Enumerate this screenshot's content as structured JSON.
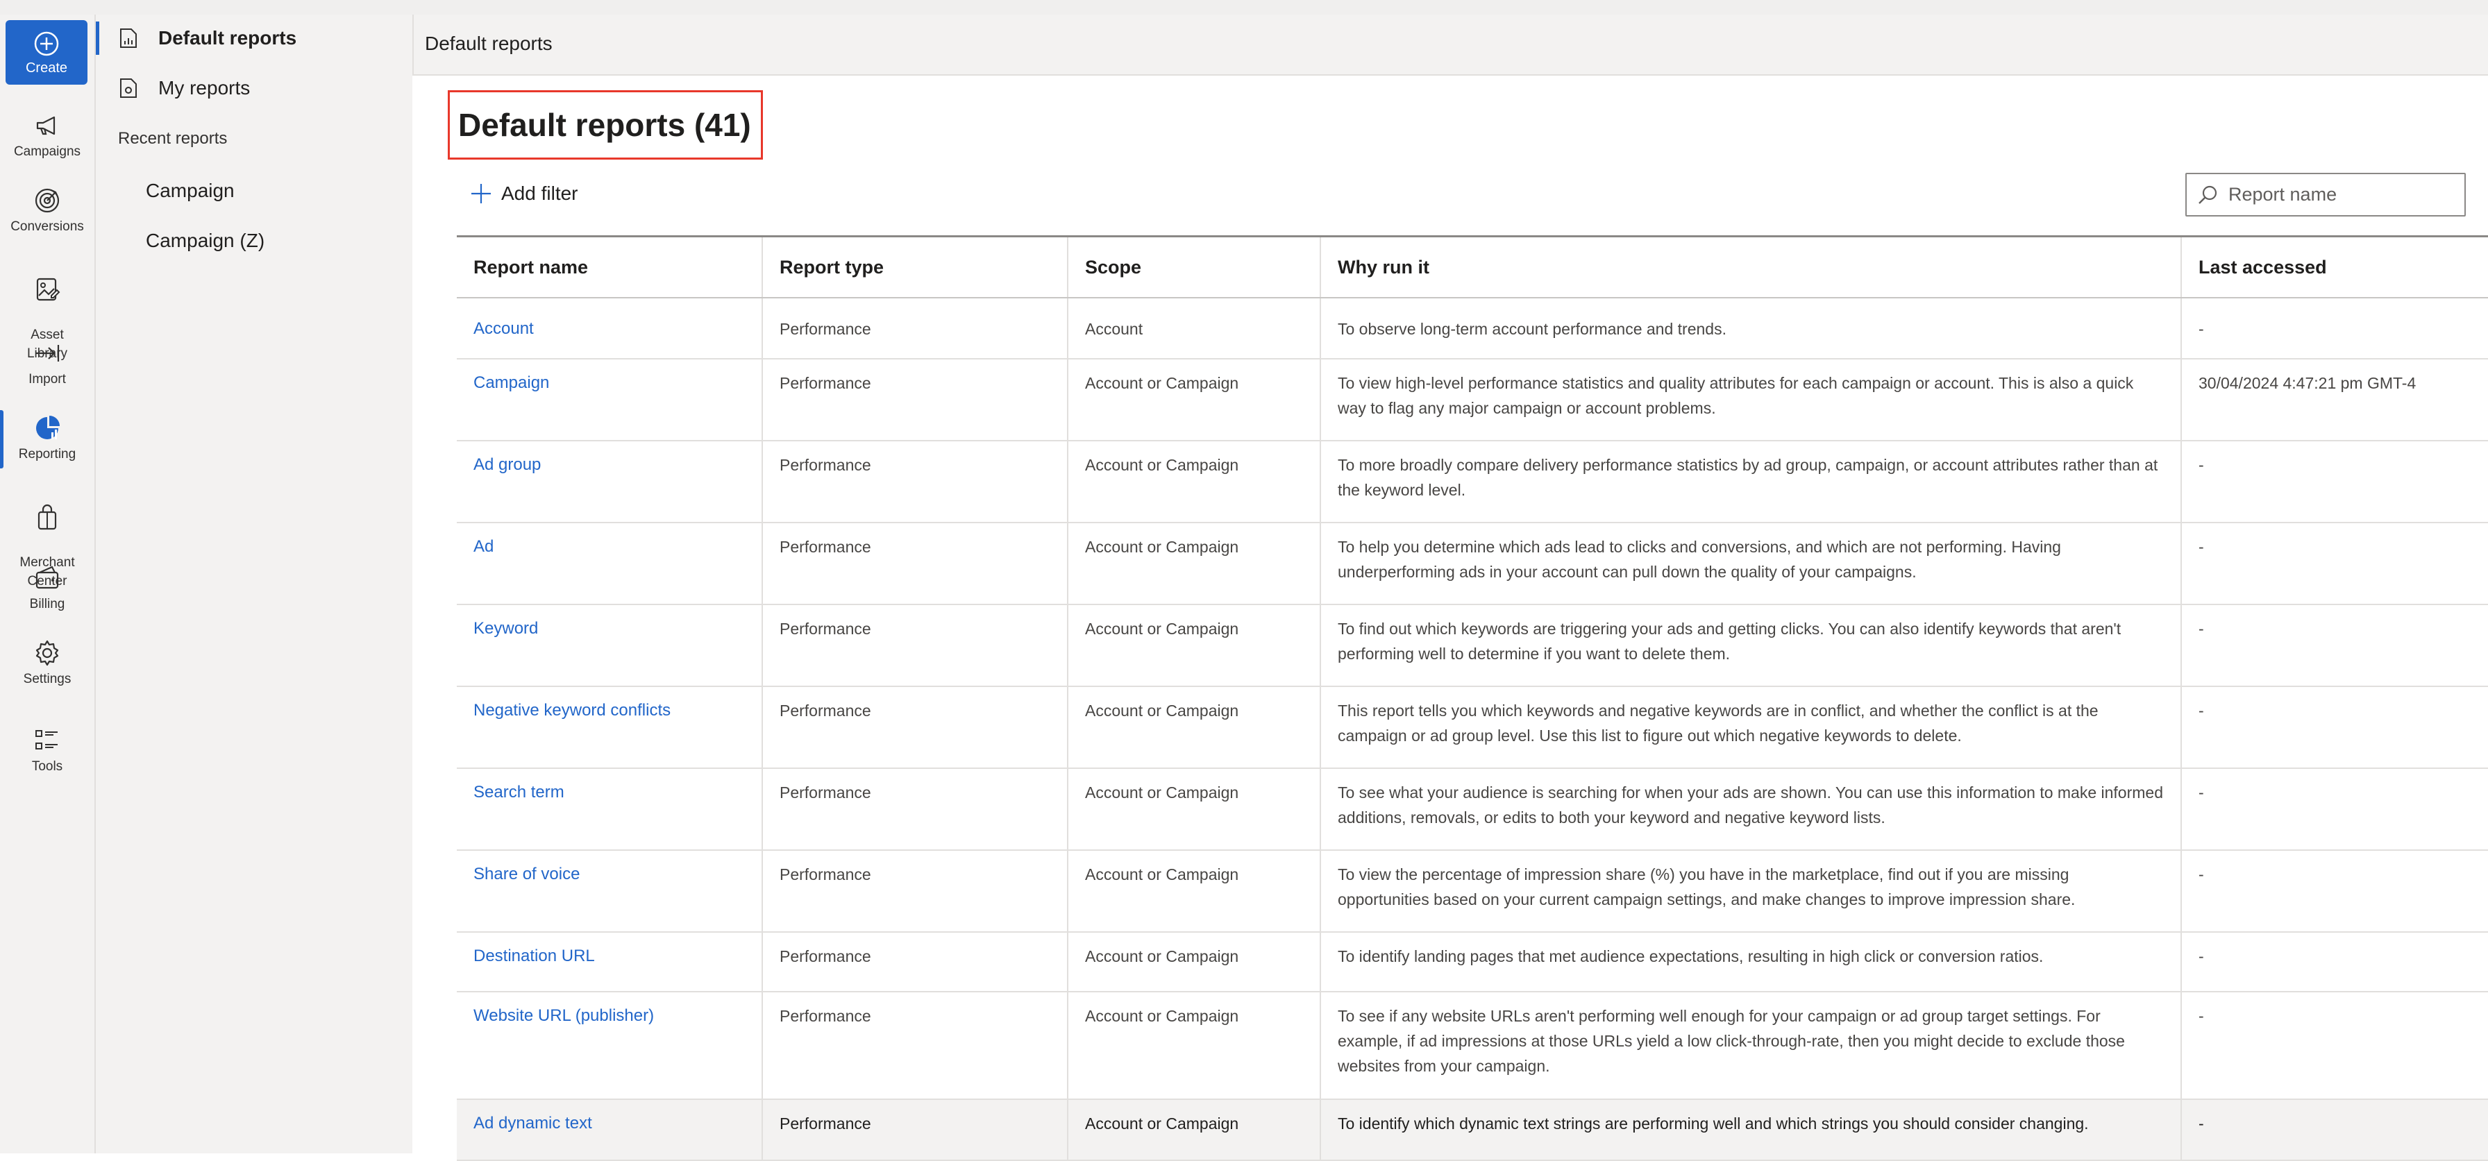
{
  "rail": {
    "create": "Create",
    "items": [
      {
        "label": "Campaigns",
        "icon": "megaphone-icon"
      },
      {
        "label": "Conversions",
        "icon": "target-icon"
      },
      {
        "label": "Asset\nLibrary",
        "icon": "asset-library-icon"
      },
      {
        "label": "Import",
        "icon": "import-icon"
      },
      {
        "label": "Reporting",
        "icon": "pie-chart-icon"
      },
      {
        "label": "Merchant\nCenter",
        "icon": "shopping-bag-icon"
      },
      {
        "label": "Billing",
        "icon": "wallet-icon"
      },
      {
        "label": "Settings",
        "icon": "gear-icon"
      },
      {
        "label": "Tools",
        "icon": "list-icon"
      }
    ]
  },
  "subnav": {
    "default_reports": "Default reports",
    "my_reports": "My reports",
    "recent_heading": "Recent reports",
    "recent": [
      "Campaign",
      "Campaign (Z)"
    ]
  },
  "header": {
    "breadcrumb": "Default reports"
  },
  "main": {
    "title": "Default reports (41)",
    "add_filter": "Add filter",
    "search_placeholder": "Report name"
  },
  "table": {
    "columns": [
      "Report name",
      "Report type",
      "Scope",
      "Why run it",
      "Last accessed"
    ],
    "rows": [
      {
        "name": "Account",
        "type": "Performance",
        "scope": "Account",
        "why": "To observe long-term account performance and trends.",
        "last": "-"
      },
      {
        "name": "Campaign",
        "type": "Performance",
        "scope": "Account or Campaign",
        "why": "To view high-level performance statistics and quality attributes for each campaign or account. This is also a quick way to flag any major campaign or account problems.",
        "last": "30/04/2024 4:47:21 pm GMT-4"
      },
      {
        "name": "Ad group",
        "type": "Performance",
        "scope": "Account or Campaign",
        "why": "To more broadly compare delivery performance statistics by ad group, campaign, or account attributes rather than at the keyword level.",
        "last": "-"
      },
      {
        "name": "Ad",
        "type": "Performance",
        "scope": "Account or Campaign",
        "why": "To help you determine which ads lead to clicks and conversions, and which are not performing. Having underperforming ads in your account can pull down the quality of your campaigns.",
        "last": "-"
      },
      {
        "name": "Keyword",
        "type": "Performance",
        "scope": "Account or Campaign",
        "why": "To find out which keywords are triggering your ads and getting clicks. You can also identify keywords that aren't performing well to determine if you want to delete them.",
        "last": "-"
      },
      {
        "name": "Negative keyword conflicts",
        "type": "Performance",
        "scope": "Account or Campaign",
        "why": "This report tells you which keywords and negative keywords are in conflict, and whether the conflict is at the campaign or ad group level. Use this list to figure out which negative keywords to delete.",
        "last": "-"
      },
      {
        "name": "Search term",
        "type": "Performance",
        "scope": "Account or Campaign",
        "why": "To see what your audience is searching for when your ads are shown. You can use this information to make informed additions, removals, or edits to both your keyword and negative keyword lists.",
        "last": "-"
      },
      {
        "name": "Share of voice",
        "type": "Performance",
        "scope": "Account or Campaign",
        "why": "To view the percentage of impression share (%)  you have in the marketplace, find out if you are missing opportunities based on your current campaign settings, and make changes to improve impression share.",
        "last": "-"
      },
      {
        "name": "Destination URL",
        "type": "Performance",
        "scope": "Account or Campaign",
        "why": "To identify landing pages that met audience expectations, resulting in high click or conversion ratios.",
        "last": "-"
      },
      {
        "name": "Website URL (publisher)",
        "type": "Performance",
        "scope": "Account or Campaign",
        "why": "To see if any website URLs aren't performing well enough for your campaign or ad group target settings. For example, if ad impressions at those URLs yield a low click-through-rate, then you might decide to exclude those websites from your campaign.",
        "last": "-"
      },
      {
        "name": "Ad dynamic text",
        "type": "Performance",
        "scope": "Account or Campaign",
        "why": "To identify which dynamic text strings are performing well and which strings you should consider changing.",
        "last": "-"
      }
    ]
  }
}
